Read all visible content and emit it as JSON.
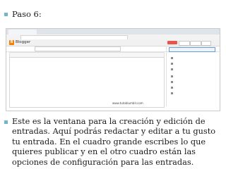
{
  "step_title": "Paso 6:",
  "paragraph": "Este es la ventana para la creación y edición de entradas. Aquí podrás redactar y editar a tu gusto tu entrada. En el cuadro grande escribes lo que quieres publicar y en el otro cuadro están las opciones de configuración para las entradas.",
  "screenshot": {
    "logo_letter": "B",
    "app_name": "Blogger",
    "watermark": "www.tutoblumblr.com"
  },
  "colors": {
    "bullet": "#6fb7c9",
    "blogger_orange": "#f57d00",
    "publish_button": "#e8534a"
  }
}
